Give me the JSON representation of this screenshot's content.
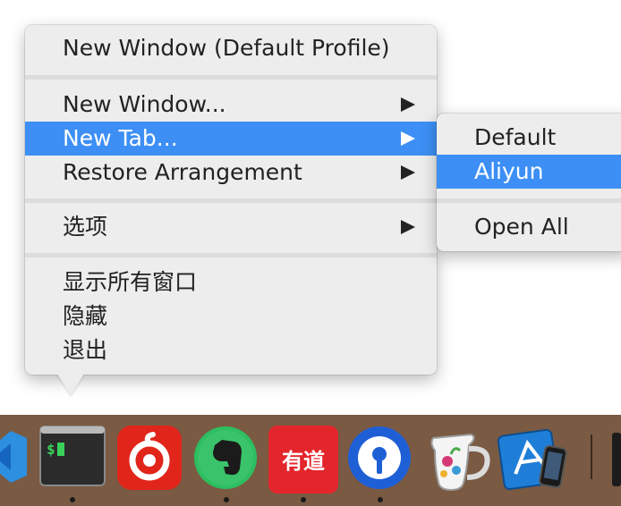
{
  "menu": {
    "items": [
      {
        "label": "New Window (Default Profile)",
        "submenu": false,
        "highlighted": false
      },
      {
        "label": "New Window...",
        "submenu": true,
        "highlighted": false
      },
      {
        "label": "New Tab...",
        "submenu": true,
        "highlighted": true
      },
      {
        "label": "Restore Arrangement",
        "submenu": true,
        "highlighted": false
      },
      {
        "label": "选项",
        "submenu": true,
        "highlighted": false
      },
      {
        "label": "显示所有窗口",
        "submenu": false,
        "highlighted": false
      },
      {
        "label": "隐藏",
        "submenu": false,
        "highlighted": false
      },
      {
        "label": "退出",
        "submenu": false,
        "highlighted": false
      }
    ]
  },
  "submenu": {
    "items": [
      {
        "label": "Default",
        "highlighted": false
      },
      {
        "label": "Aliyun",
        "highlighted": true
      },
      {
        "label": "Open All",
        "highlighted": false
      }
    ]
  },
  "dock": {
    "apps": [
      {
        "icon": "vscode-icon",
        "running": false
      },
      {
        "icon": "iterm-terminal-icon",
        "running": true,
        "glyph": "$"
      },
      {
        "icon": "netease-music-icon",
        "running": false
      },
      {
        "icon": "evernote-icon",
        "running": true
      },
      {
        "icon": "youdao-dictionary-icon",
        "running": true,
        "glyph": "有道"
      },
      {
        "icon": "teamviewer-style-blue-icon",
        "running": true
      },
      {
        "icon": "creamer-pitcher-icon",
        "running": false
      },
      {
        "icon": "xcode-simulator-icon",
        "running": false
      }
    ]
  },
  "colors": {
    "highlight": "#3d8ff5",
    "menu_bg": "#ededed",
    "dock_bg": "#7a5a43"
  }
}
